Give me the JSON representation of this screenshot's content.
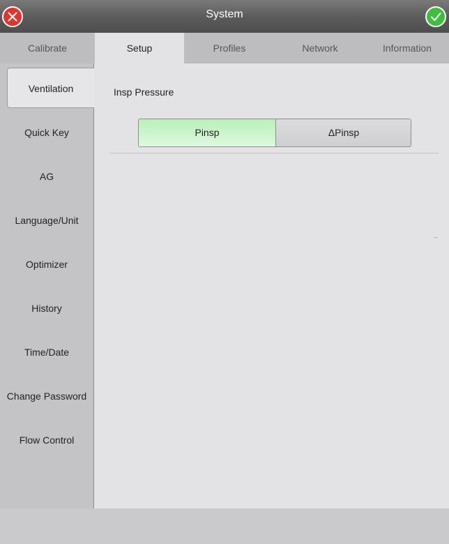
{
  "window": {
    "title": "System"
  },
  "title_buttons": {
    "close_icon": "close-circle-icon",
    "confirm_icon": "check-circle-icon"
  },
  "tabs": [
    {
      "label": "Calibrate",
      "active": false
    },
    {
      "label": "Setup",
      "active": true
    },
    {
      "label": "Profiles",
      "active": false
    },
    {
      "label": "Network",
      "active": false
    },
    {
      "label": "Information",
      "active": false
    }
  ],
  "sidebar": {
    "items": [
      {
        "label": "Ventilation",
        "active": true
      },
      {
        "label": "Quick Key",
        "active": false
      },
      {
        "label": "AG",
        "active": false
      },
      {
        "label": "Language/Unit",
        "active": false
      },
      {
        "label": "Optimizer",
        "active": false
      },
      {
        "label": "History",
        "active": false
      },
      {
        "label": "Time/Date",
        "active": false
      },
      {
        "label": "Change Password",
        "active": false
      },
      {
        "label": "Flow Control",
        "active": false
      }
    ]
  },
  "content": {
    "section_label": "Insp Pressure",
    "options": [
      {
        "label": "Pinsp",
        "selected": true
      },
      {
        "label": "ΔPinsp",
        "selected": false
      }
    ]
  },
  "colors": {
    "close": "#e5322b",
    "confirm": "#3dbf3d",
    "selected_option": "#c8f4c8"
  }
}
